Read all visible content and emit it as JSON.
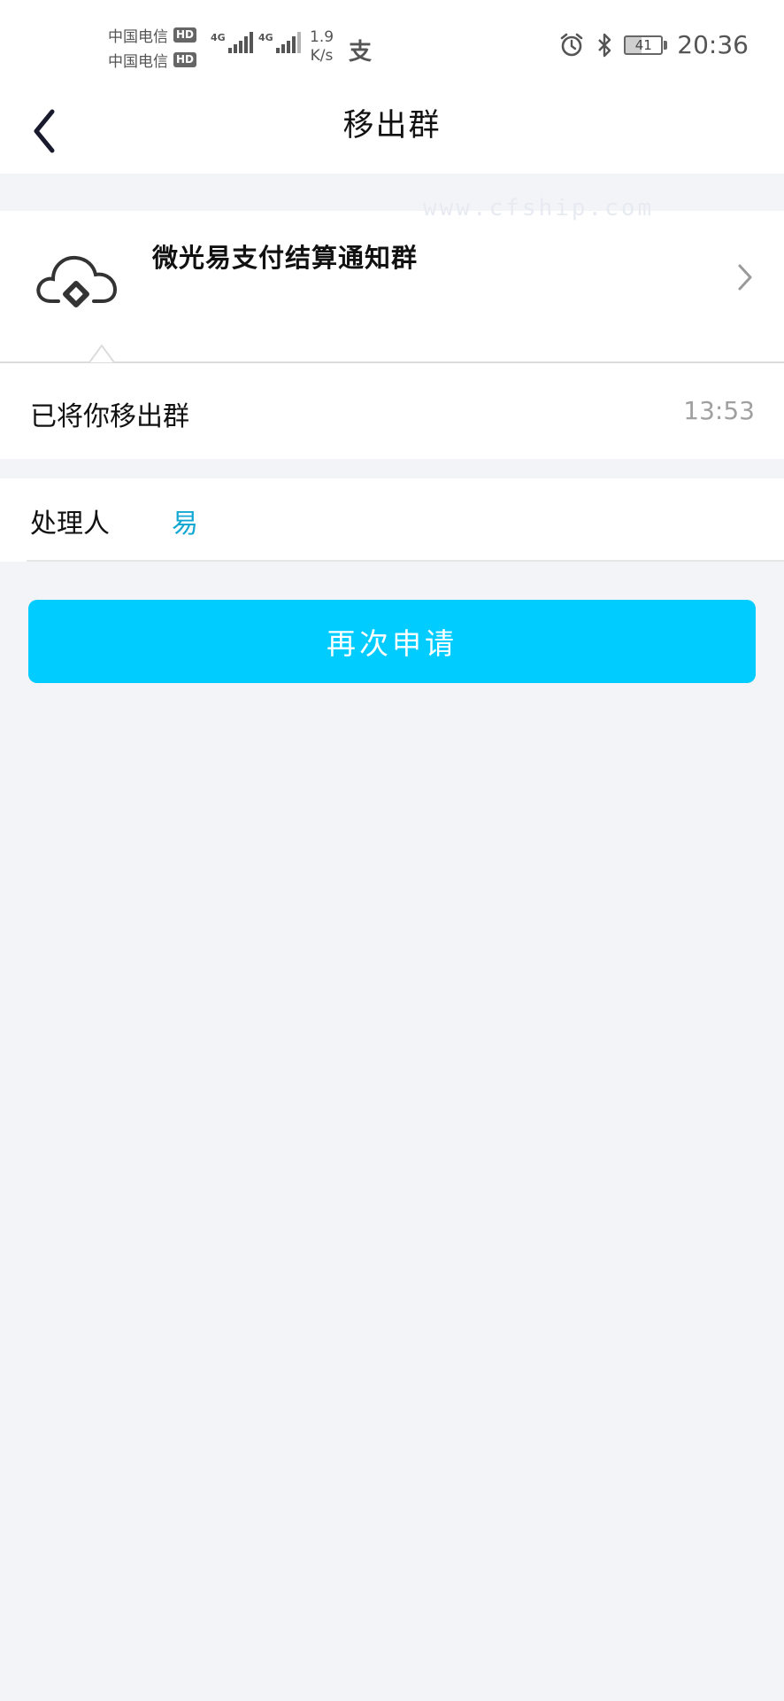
{
  "status_bar": {
    "carrier_1": "中国电信",
    "carrier_2": "中国电信",
    "hd_badge": "HD",
    "network_1": "4G",
    "network_2": "4G",
    "speed_value": "1.9",
    "speed_unit": "K/s",
    "alipay_glyph": "支",
    "battery_level": "41",
    "time": "20:36",
    "icons": [
      "alarm-icon",
      "bluetooth-icon",
      "battery-icon"
    ]
  },
  "nav": {
    "title": "移出群",
    "back_icon": "chevron-left-icon"
  },
  "group": {
    "name": "微光易支付结算通知群",
    "watermark": "www.cfship.com",
    "icon": "cloud-logo-icon"
  },
  "message": {
    "text": "已将你移出群",
    "time": "13:53"
  },
  "handler": {
    "label": "处理人",
    "name": "易"
  },
  "actions": {
    "reapply_label": "再次申请"
  },
  "colors": {
    "accent": "#00ccff",
    "link": "#12a8d4",
    "background": "#f2f4f8"
  }
}
